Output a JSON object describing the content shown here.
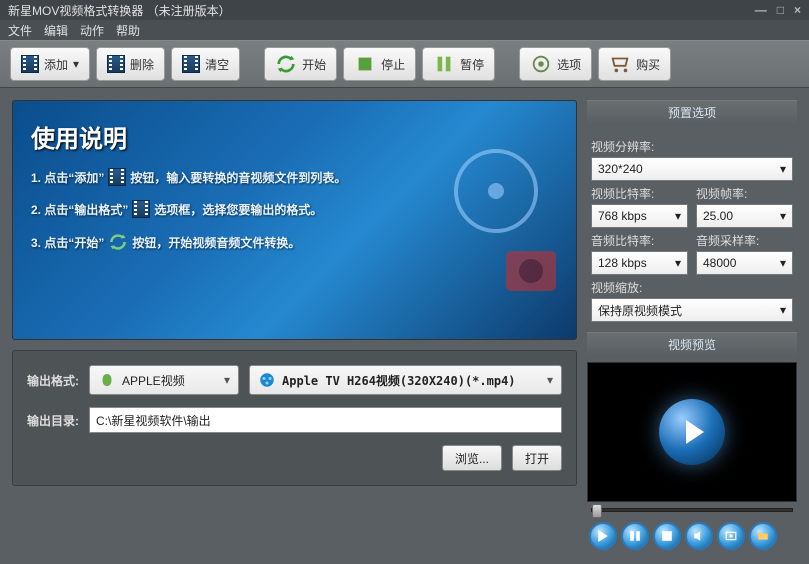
{
  "title": "新星MOV视频格式转换器 （未注册版本）",
  "menu": {
    "file": "文件",
    "edit": "编辑",
    "action": "动作",
    "help": "帮助"
  },
  "toolbar": {
    "add": "添加",
    "delete": "删除",
    "clear": "清空",
    "start": "开始",
    "stop": "停止",
    "pause": "暂停",
    "options": "选项",
    "buy": "购买"
  },
  "instruct": {
    "title": "使用说明",
    "s1a": "1. 点击“添加”",
    "s1b": "按钮，输入要转换的音视频文件到列表。",
    "s2a": "2. 点击“输出格式”",
    "s2b": "选项框，选择您要输出的格式。",
    "s3a": "3. 点击“开始”",
    "s3b": "按钮，开始视频音频文件转换。"
  },
  "output": {
    "format_label": "输出格式:",
    "format_cat": "APPLE视频",
    "format_sel": "Apple TV H264视频(320X240)(*.mp4)",
    "dir_label": "输出目录:",
    "dir_value": "C:\\新星视频软件\\输出",
    "browse": "浏览...",
    "open": "打开"
  },
  "preset": {
    "title": "预置选项",
    "res_label": "视频分辨率:",
    "res": "320*240",
    "vbr_label": "视频比特率:",
    "vbr": "768 kbps",
    "fps_label": "视频帧率:",
    "fps": "25.00",
    "abr_label": "音频比特率:",
    "abr": "128 kbps",
    "asr_label": "音频采样率:",
    "asr": "48000",
    "scale_label": "视频缩放:",
    "scale": "保持原视频模式"
  },
  "preview": {
    "title": "视频预览"
  }
}
